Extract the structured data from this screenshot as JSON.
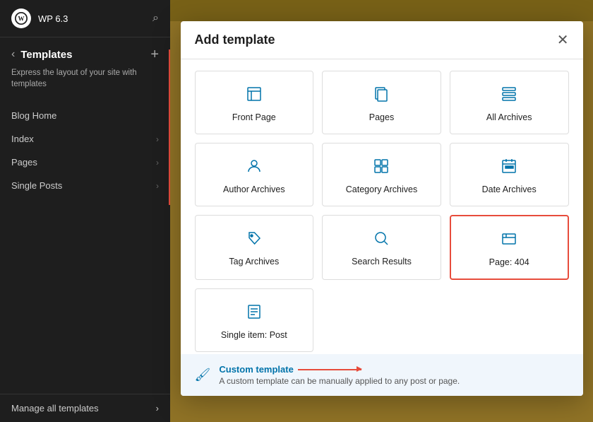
{
  "sidebar": {
    "site_name": "WP 6.3",
    "title": "Templates",
    "description": "Express the layout of your site with templates",
    "add_label": "+",
    "nav_items": [
      {
        "label": "Blog Home",
        "has_chevron": false
      },
      {
        "label": "Index",
        "has_chevron": true
      },
      {
        "label": "Pages",
        "has_chevron": true
      },
      {
        "label": "Single Posts",
        "has_chevron": true
      }
    ],
    "manage_label": "Manage all templates"
  },
  "modal": {
    "title": "Add template",
    "close_label": "✕",
    "templates": [
      {
        "id": "front-page",
        "label": "Front Page",
        "icon": "front-page"
      },
      {
        "id": "pages",
        "label": "Pages",
        "icon": "pages"
      },
      {
        "id": "all-archives",
        "label": "All Archives",
        "icon": "all-archives"
      },
      {
        "id": "author-archives",
        "label": "Author Archives",
        "icon": "author-archives"
      },
      {
        "id": "category-archives",
        "label": "Category Archives",
        "icon": "category-archives"
      },
      {
        "id": "date-archives",
        "label": "Date Archives",
        "icon": "date-archives"
      },
      {
        "id": "tag-archives",
        "label": "Tag Archives",
        "icon": "tag-archives"
      },
      {
        "id": "search-results",
        "label": "Search Results",
        "icon": "search-results"
      },
      {
        "id": "page-404",
        "label": "Page: 404",
        "icon": "page-404",
        "highlighted": true
      }
    ],
    "single_items": [
      {
        "id": "single-post",
        "label": "Single item: Post",
        "icon": "single-post"
      }
    ],
    "footer": {
      "custom_template_label": "Custom template",
      "custom_template_desc": "A custom template can be manually applied to any post or page."
    }
  },
  "colors": {
    "accent": "#0073aa",
    "highlight_border": "#e74c3c",
    "header_bg": "#f0c040"
  }
}
